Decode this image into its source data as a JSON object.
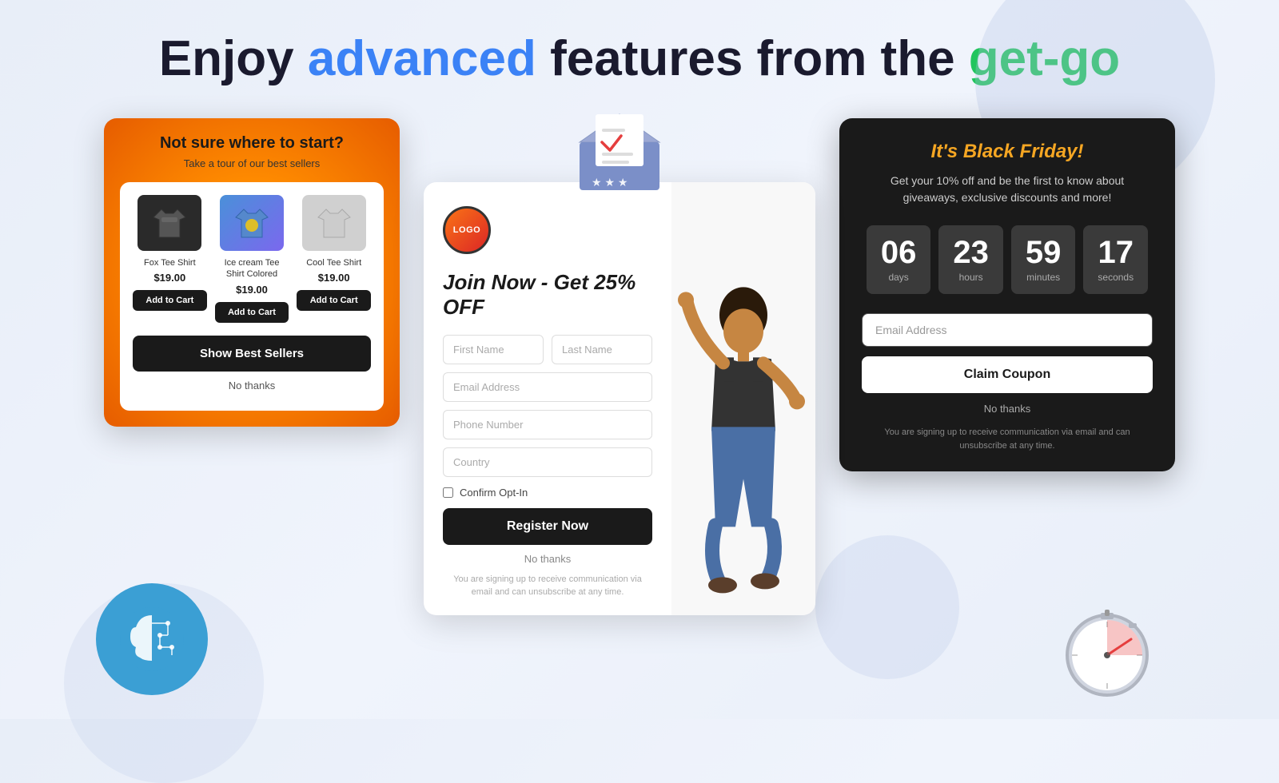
{
  "header": {
    "part1": "Enjoy ",
    "part2": "advanced",
    "part3": " features from the ",
    "part4": "get-go"
  },
  "product_popup": {
    "title": "Not sure where to start?",
    "subtitle": "Take a tour of our best sellers",
    "products": [
      {
        "name": "Fox Tee Shirt",
        "price": "$19.00",
        "color": "black"
      },
      {
        "name": "Ice cream Tee Shirt Colored",
        "price": "$19.00",
        "color": "colored"
      },
      {
        "name": "Cool Tee Shirt",
        "price": "$19.00",
        "color": "gray"
      }
    ],
    "add_cart_label": "Add to Cart",
    "show_best_label": "Show Best Sellers",
    "no_thanks_label": "No thanks"
  },
  "reg_popup": {
    "logo_text": "LOGO",
    "title": "Join Now - Get 25% OFF",
    "fields": {
      "first_name": "First Name",
      "last_name": "Last Name",
      "email": "Email Address",
      "phone": "Phone Number",
      "country": "Country"
    },
    "checkbox_label": "Confirm Opt-In",
    "register_label": "Register Now",
    "no_thanks_label": "No thanks",
    "disclaimer": "You are signing up to receive communication via email and can unsubscribe at any time."
  },
  "bf_popup": {
    "title": "It's Black Friday!",
    "subtitle": "Get your 10% off and be the first to know about giveaways, exclusive discounts and more!",
    "countdown": {
      "days": {
        "value": "06",
        "label": "days"
      },
      "hours": {
        "value": "23",
        "label": "hours"
      },
      "minutes": {
        "value": "59",
        "label": "minutes"
      },
      "seconds": {
        "value": "17",
        "label": "seconds"
      }
    },
    "email_placeholder": "Email Address",
    "claim_label": "Claim Coupon",
    "no_thanks_label": "No thanks",
    "disclaimer": "You are signing up to receive communication via email and can unsubscribe at any time."
  },
  "colors": {
    "blue_accent": "#3b82f6",
    "green_accent": "#22c55e",
    "orange_title": "#f5a623"
  }
}
